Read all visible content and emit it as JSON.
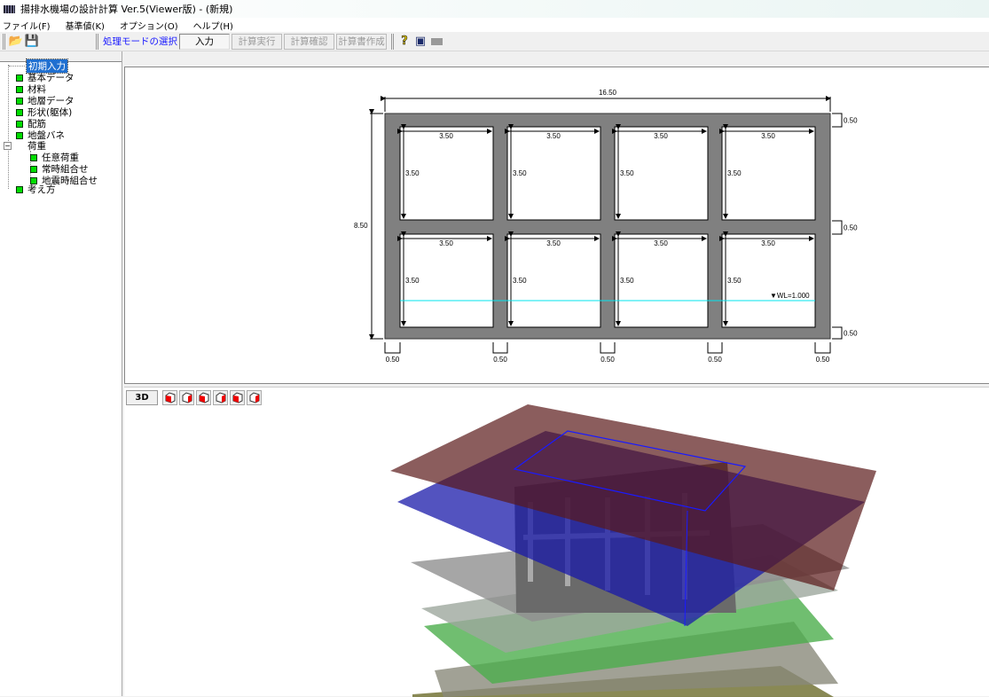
{
  "window": {
    "title": "揚排水機場の設計計算 Ver.5(Viewer版) - (新規)"
  },
  "menu": [
    "ファイル(F)",
    "基準値(K)",
    "オプション(O)",
    "ヘルプ(H)"
  ],
  "toolbar": {
    "mode_label": "処理モードの選択",
    "buttons": [
      "入力",
      "計算実行",
      "計算確認",
      "計算書作成"
    ],
    "active_button": "入力"
  },
  "tree": {
    "items": [
      {
        "label": "初期入力",
        "selected": true
      },
      {
        "label": "基本データ"
      },
      {
        "label": "材料"
      },
      {
        "label": "地層データ"
      },
      {
        "label": "形状(躯体)"
      },
      {
        "label": "配筋"
      },
      {
        "label": "地盤バネ"
      },
      {
        "label": "荷重",
        "expanded": true
      },
      {
        "label": "任意荷重"
      },
      {
        "label": "常時組合せ"
      },
      {
        "label": "地震時組合せ"
      },
      {
        "label": "考え方"
      }
    ]
  },
  "drawing": {
    "overall_width": "16.50",
    "overall_height": "8.50",
    "cell_dim": "3.50",
    "wall_thickness": "0.50",
    "water_level": "▼WL=1.000",
    "water_color": "#00e5ee",
    "concrete_color": "#808080"
  },
  "view3d": {
    "button_3d": "3D",
    "view_buttons": [
      "front-view",
      "right-view",
      "top-view",
      "left-view",
      "back-view",
      "bottom-view"
    ]
  }
}
